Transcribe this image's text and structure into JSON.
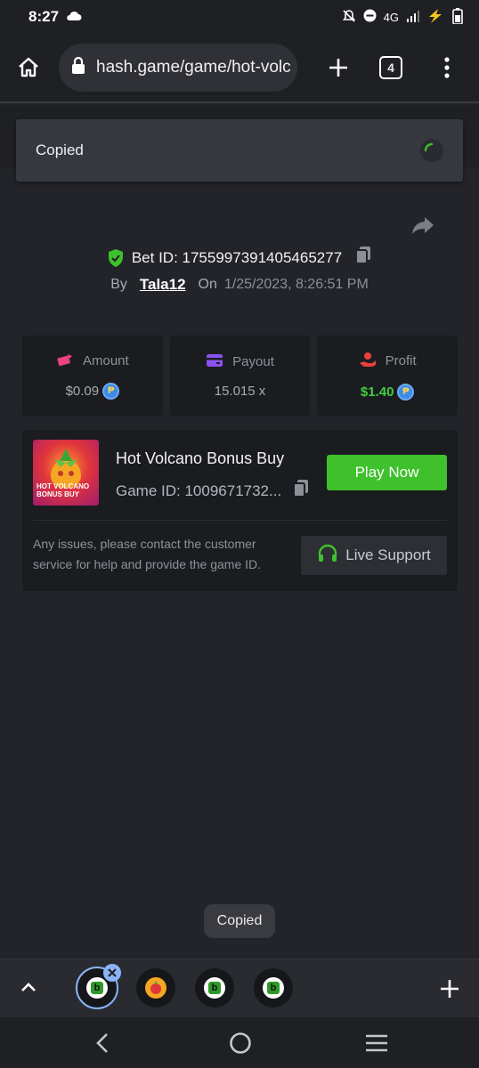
{
  "status": {
    "time": "8:27",
    "network": "4G"
  },
  "browser": {
    "url": "hash.game/game/hot-volc",
    "tab_count": "4"
  },
  "toast_top": {
    "label": "Copied"
  },
  "bet": {
    "bet_label": "Bet ID: 1755997391405465277",
    "by_label": "By",
    "user": "Tala12",
    "on_label": "On",
    "date": "1/25/2023, 8:26:51 PM"
  },
  "stats": [
    {
      "label": "Amount",
      "value": "$0.09",
      "icon": "money-wings-icon",
      "color": "#e8467a"
    },
    {
      "label": "Payout",
      "value": "15.015 x",
      "icon": "wallet-icon",
      "color": "#8b52f0"
    },
    {
      "label": "Profit",
      "value": "$1.40",
      "icon": "hand-coins-icon",
      "color": "#e8423c"
    }
  ],
  "coin_symbol": "₱",
  "game": {
    "title": "Hot Volcano Bonus Buy",
    "game_id": "Game ID: 1009671732...",
    "thumb_text": "HOT VOLCANO BONUS BUY",
    "play_label": "Play Now",
    "help_text": "Any issues, please contact the customer service for help and provide the game ID.",
    "support_label": "Live Support"
  },
  "toast_bottom": {
    "label": "Copied"
  },
  "colors": {
    "accent_green": "#3ec12c",
    "profit_green": "#3fcf3f",
    "tab_highlight": "#8ab4f8"
  }
}
